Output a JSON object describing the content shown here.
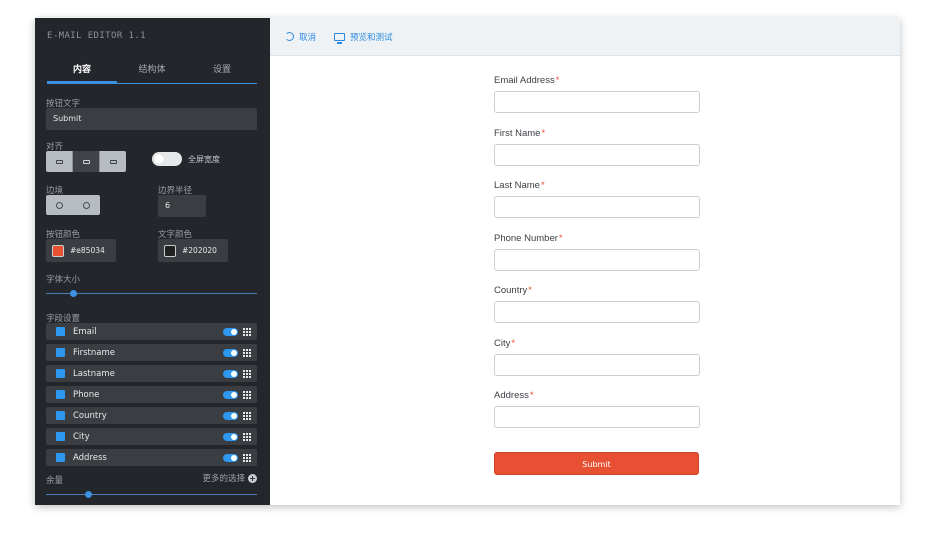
{
  "app": {
    "title": "E-MAIL EDITOR 1.1"
  },
  "tabs": [
    {
      "label": "内容",
      "active": true
    },
    {
      "label": "结构体",
      "active": false
    },
    {
      "label": "设置",
      "active": false
    }
  ],
  "content": {
    "button_text_label": "按钮文字",
    "button_text_value": "Submit",
    "align_label": "对齐",
    "fullwidth_label": "全屏宽度",
    "border_label": "边境",
    "radius_label": "边界半径",
    "radius_value": "6",
    "button_color_label": "按钮颜色",
    "button_color_value": "#e85034",
    "text_color_label": "文字颜色",
    "text_color_value": "#202020",
    "font_size_label": "字体大小",
    "fields_label": "字段设置",
    "fields": [
      {
        "name": "Email"
      },
      {
        "name": "Firstname"
      },
      {
        "name": "Lastname"
      },
      {
        "name": "Phone"
      },
      {
        "name": "Country"
      },
      {
        "name": "City"
      },
      {
        "name": "Address"
      }
    ],
    "margin_label": "余量",
    "more_options_label": "更多的选择"
  },
  "toolbar": {
    "cancel_label": "取消",
    "preview_label": "预览和测试"
  },
  "form": {
    "fields": [
      {
        "label": "Email Address",
        "required_mark": "*"
      },
      {
        "label": "First Name",
        "required_mark": "*"
      },
      {
        "label": "Last Name",
        "required_mark": "*"
      },
      {
        "label": "Phone Number",
        "required_mark": "*"
      },
      {
        "label": "Country",
        "required_mark": "*"
      },
      {
        "label": "City",
        "required_mark": "*"
      },
      {
        "label": "Address",
        "required_mark": "*"
      }
    ],
    "submit_label": "Submit"
  },
  "colors": {
    "accent": "#2e97f0",
    "submit": "#e85034",
    "sidebar_bg": "#23262b"
  }
}
